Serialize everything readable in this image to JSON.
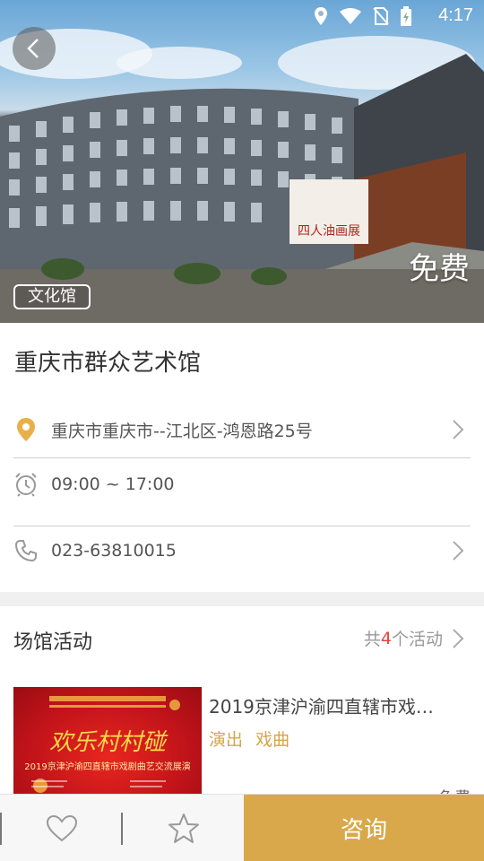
{
  "status_bar": {
    "time": "4:17",
    "icons": [
      "location-icon",
      "wifi-icon",
      "no-sim-icon",
      "battery-icon"
    ]
  },
  "hero": {
    "category": "文化馆",
    "price": "免费",
    "sign_text": "四人油画展"
  },
  "venue": {
    "name": "重庆市群众艺术馆",
    "address": "重庆市重庆市--江北区-鸿恩路25号",
    "hours": "09:00 ~ 17:00",
    "phone": "023-63810015"
  },
  "activities": {
    "title": "场馆活动",
    "more_prefix": "共",
    "count": "4",
    "more_suffix": "个活动",
    "items": [
      {
        "title": "2019京津沪渝四直辖市戏…",
        "tags": [
          "演出",
          "戏曲"
        ],
        "price": "免费",
        "thumb_text_1": "欢乐村村碰",
        "thumb_text_2": "2019京津沪渝四直辖市戏剧曲艺交流展演"
      }
    ]
  },
  "bottom_bar": {
    "consult_label": "咨询"
  },
  "colors": {
    "accent": "#d9a84a",
    "count_red": "#e6423a",
    "tag_gold": "#d5a64a"
  }
}
